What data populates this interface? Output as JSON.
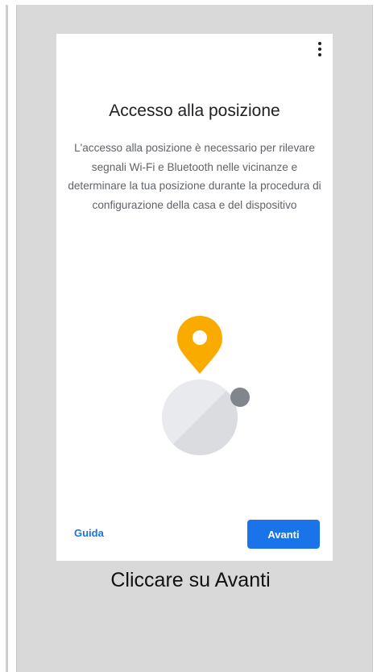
{
  "screen": {
    "title": "Accesso alla posizione",
    "description": "L'accesso alla posizione è necessario per rilevare segnali Wi-Fi e Bluetooth nelle vicinanze e determinare la tua posizione durante la procedura di configurazione della casa e del dispositivo",
    "more_icon": "more-vert-icon",
    "illustration": {
      "pin_icon": "location-pin-icon",
      "pin_color": "#f9ab00",
      "dot_color": "#80868b",
      "circle_color": "#e8eaed"
    }
  },
  "footer": {
    "help_label": "Guida",
    "next_label": "Avanti",
    "accent_color": "#1a73e8"
  },
  "caption": "Cliccare su Avanti"
}
